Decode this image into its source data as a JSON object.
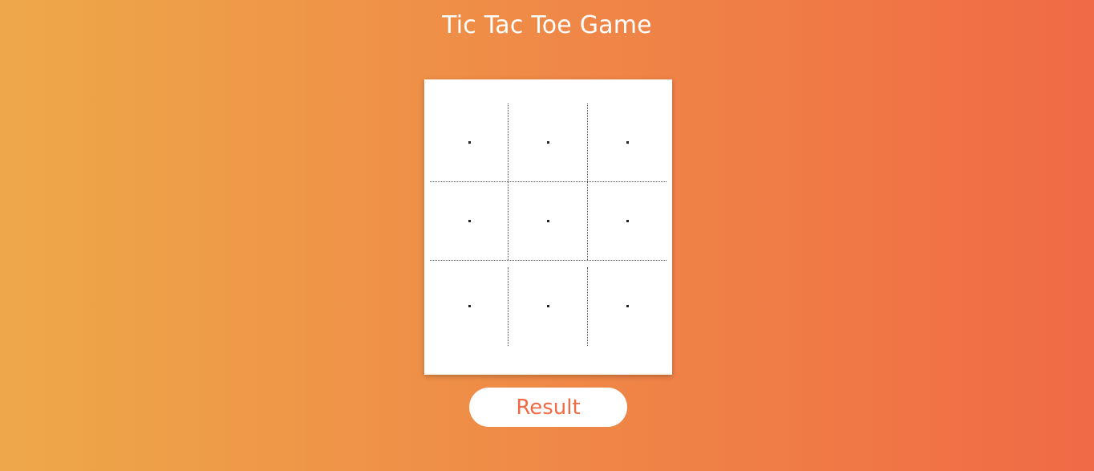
{
  "page": {
    "title": "Tic Tac Toe Game"
  },
  "board": {
    "cells": [
      {
        "id": 1,
        "value": ""
      },
      {
        "id": 2,
        "value": ""
      },
      {
        "id": 3,
        "value": ""
      },
      {
        "id": 4,
        "value": ""
      },
      {
        "id": 5,
        "value": ""
      },
      {
        "id": 6,
        "value": ""
      },
      {
        "id": 7,
        "value": ""
      },
      {
        "id": 8,
        "value": ""
      },
      {
        "id": 9,
        "value": ""
      }
    ]
  },
  "actions": {
    "result_label": "Result"
  },
  "colors": {
    "gradient_start": "#EEA849",
    "gradient_end": "#F06A45",
    "accent": "#F06A45",
    "card": "#FFFFFF"
  }
}
